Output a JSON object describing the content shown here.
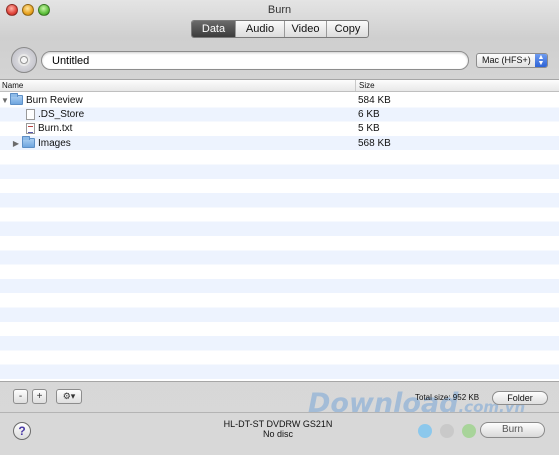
{
  "window": {
    "title": "Burn"
  },
  "tabs": [
    "Data",
    "Audio",
    "Video",
    "Copy"
  ],
  "disc": {
    "name_value": "Untitled",
    "filesystem": "Mac (HFS+)"
  },
  "list": {
    "headers": {
      "name": "Name",
      "size": "Size"
    },
    "rows": [
      {
        "name": "Burn Review",
        "size": "584 KB",
        "icon": "folder-icon",
        "expanded": true
      },
      {
        "name": ".DS_Store",
        "size": "6 KB",
        "icon": "file-icon"
      },
      {
        "name": "Burn.txt",
        "size": "5 KB",
        "icon": "text-file-icon"
      },
      {
        "name": "Images",
        "size": "568 KB",
        "icon": "folder-icon",
        "expanded": false
      }
    ]
  },
  "toolbar": {
    "remove_label": "-",
    "add_label": "+",
    "gear_label": "⚙▾",
    "total_size": "Total size: 952 KB",
    "folder_label": "Folder"
  },
  "status": {
    "help_label": "?",
    "drive_name": "HL-DT-ST DVDRW GS21N",
    "drive_state": "No disc",
    "burn_label": "Burn"
  },
  "watermark": {
    "main": "Download",
    "tld": ".com.vn"
  },
  "colors": {
    "accent": "#3c6fd8",
    "dot_blue": "#8cc8ec",
    "dot_gray": "#c9c9c9",
    "dot_green": "#a8d49a",
    "dot_orange": "#f3c48a",
    "dot_red": "#ee8a86"
  }
}
